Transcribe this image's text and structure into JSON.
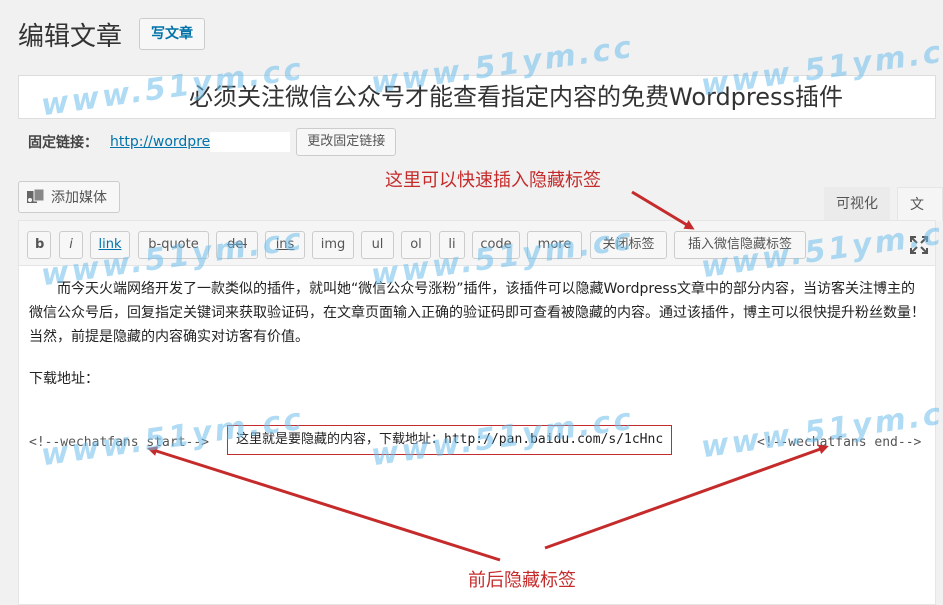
{
  "header": {
    "title": "编辑文章",
    "add_new": "写文章"
  },
  "post_title": "必须关注微信公众号才能查看指定内容的免费Wordpress插件",
  "permalink": {
    "label": "固定链接：",
    "url": "http://wordpre",
    "change_button": "更改固定链接"
  },
  "media": {
    "add_media": "添加媒体"
  },
  "modes": {
    "visual": "可视化",
    "text": "文本"
  },
  "quicktags": [
    "b",
    "i",
    "link",
    "b-quote",
    "del",
    "ins",
    "img",
    "ul",
    "ol",
    "li",
    "code",
    "more",
    "关闭标签",
    "插入微信隐藏标签"
  ],
  "content": {
    "paragraph": "而今天火端网络开发了一款类似的插件，就叫她“微信公众号涨粉”插件，该插件可以隐藏Wordpress文章中的部分内容，当访客关注博主的微信公众号后，回复指定关键词来获取验证码，在文章页面输入正确的验证码即可查看被隐藏的内容。通过该插件，博主可以很快提升粉丝数量！当然，前提是隐藏的内容确实对访客有价值。",
    "download_label": "下载地址：",
    "tag_start": "<!--wechatfans start-->",
    "hidden_content": "这里就是要隐藏的内容，下载地址：http://pan.baidu.com/s/1cHnc",
    "tag_end": "<!--wechatfans end-->"
  },
  "annotations": {
    "top": "这里可以快速插入隐藏标签",
    "bottom": "前后隐藏标签"
  },
  "watermark": "www.51ym.cc",
  "colors": {
    "annotation": "#c52b2b",
    "link": "#0073aa",
    "watermark": "#6ebeeb"
  }
}
